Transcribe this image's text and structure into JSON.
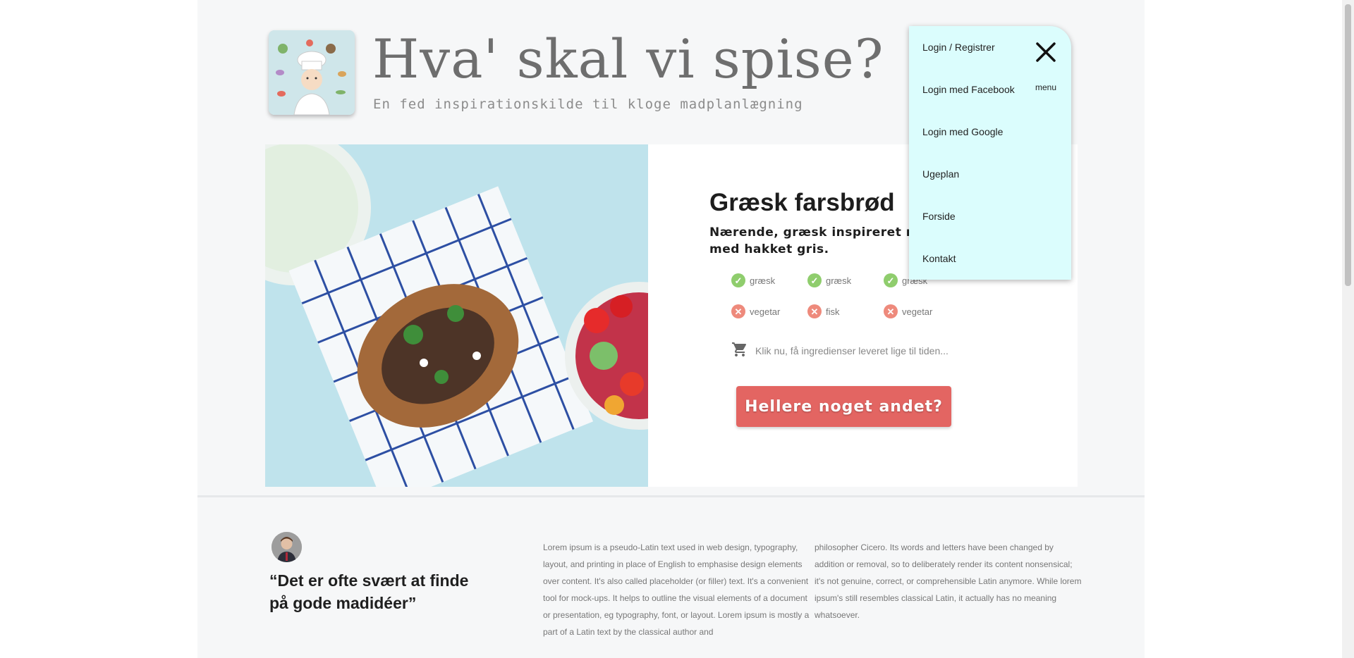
{
  "header": {
    "title": "Hva' skal vi spise?",
    "subtitle": "En fed inspirationskilde til kloge madplanlægning",
    "logo_icon": "chef-logo-icon"
  },
  "recipe": {
    "title": "Græsk farsbrød",
    "description": "Nærende, græsk inspireret måltid med hakket gris.",
    "tags_positive": [
      "græsk",
      "græsk",
      "græsk"
    ],
    "tags_negative": [
      "vegetar",
      "fisk",
      "vegetar"
    ],
    "cart_text": "Klik nu, få ingredienser leveret lige til tiden...",
    "cta_label": "Hellere noget andet?"
  },
  "menu": {
    "items": [
      "Login / Registrer",
      "Login med Facebook",
      "Login med Google",
      "Ugeplan",
      "Forside",
      "Kontakt"
    ],
    "close_label": "menu"
  },
  "testimonial": {
    "quote": "“Det er ofte svært at finde på gode madidéer”",
    "text_col1": "Lorem ipsum is a pseudo-Latin text used in web design, typography, layout, and printing in place of English to emphasise design elements over content. It's also called placeholder (or filler) text. It's a convenient tool for mock-ups. It helps to outline the visual elements of a document or presentation, eg typography, font, or layout. Lorem ipsum is mostly a part of a Latin text by the classical author and",
    "text_col2": "philosopher Cicero. Its words and letters have been changed by addition or removal, so to deliberately render its content nonsensical; it's not genuine, correct, or comprehensible Latin anymore. While lorem ipsum's still resembles classical Latin, it actually has no meaning whatsoever."
  },
  "colors": {
    "accent": "#e36562",
    "menu_bg": "#dbfdfd",
    "check": "#8fcd6d",
    "cross": "#ee8a7c"
  }
}
